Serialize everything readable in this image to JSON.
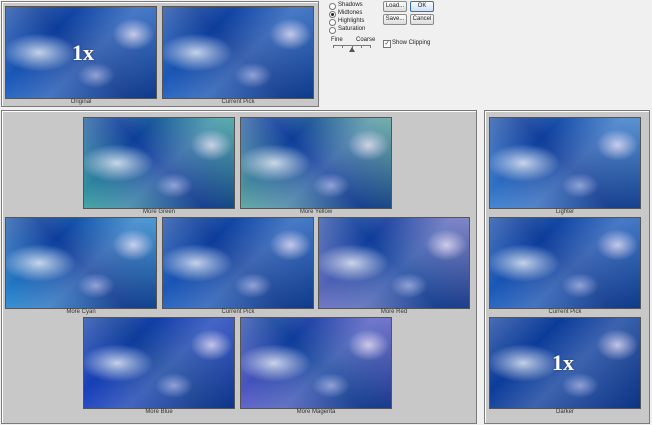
{
  "top_panel": {
    "original_caption": "Original",
    "current_pick_caption": "Current Pick",
    "zoom_label": "1x"
  },
  "tones": {
    "options": [
      "Shadows",
      "Midtones",
      "Highlights",
      "Saturation"
    ],
    "selected": "Midtones"
  },
  "buttons": {
    "load": "Load...",
    "ok": "OK",
    "save": "Save...",
    "cancel": "Cancel"
  },
  "slider": {
    "fine_label": "Fine",
    "coarse_label": "Coarse",
    "level": 0.5
  },
  "show_clipping": {
    "label": "Show Clipping",
    "checked": true
  },
  "color_grid": {
    "more_green": "More Green",
    "more_yellow": "More Yellow",
    "more_cyan": "More Cyan",
    "current_pick": "Current Pick",
    "more_red": "More Red",
    "more_blue": "More Blue",
    "more_magenta": "More Magenta"
  },
  "lightness": {
    "lighter": "Lighter",
    "current_pick": "Current Pick",
    "darker": "Darker",
    "zoom_label": "1x"
  },
  "colors": {
    "panel_bg": "#c8c8c8",
    "base_blue": "#1e5fbf",
    "green_tint": "#3aa0a0",
    "yellow_tint": "#5aa5a0",
    "cyan_tint": "#2a8ad0",
    "red_tint": "#6a70c0",
    "blue_tint": "#1a40c0",
    "magenta_tint": "#5a5cc8",
    "light_tint": "#3a7fd0",
    "dark_tint": "#0c3c9a"
  }
}
